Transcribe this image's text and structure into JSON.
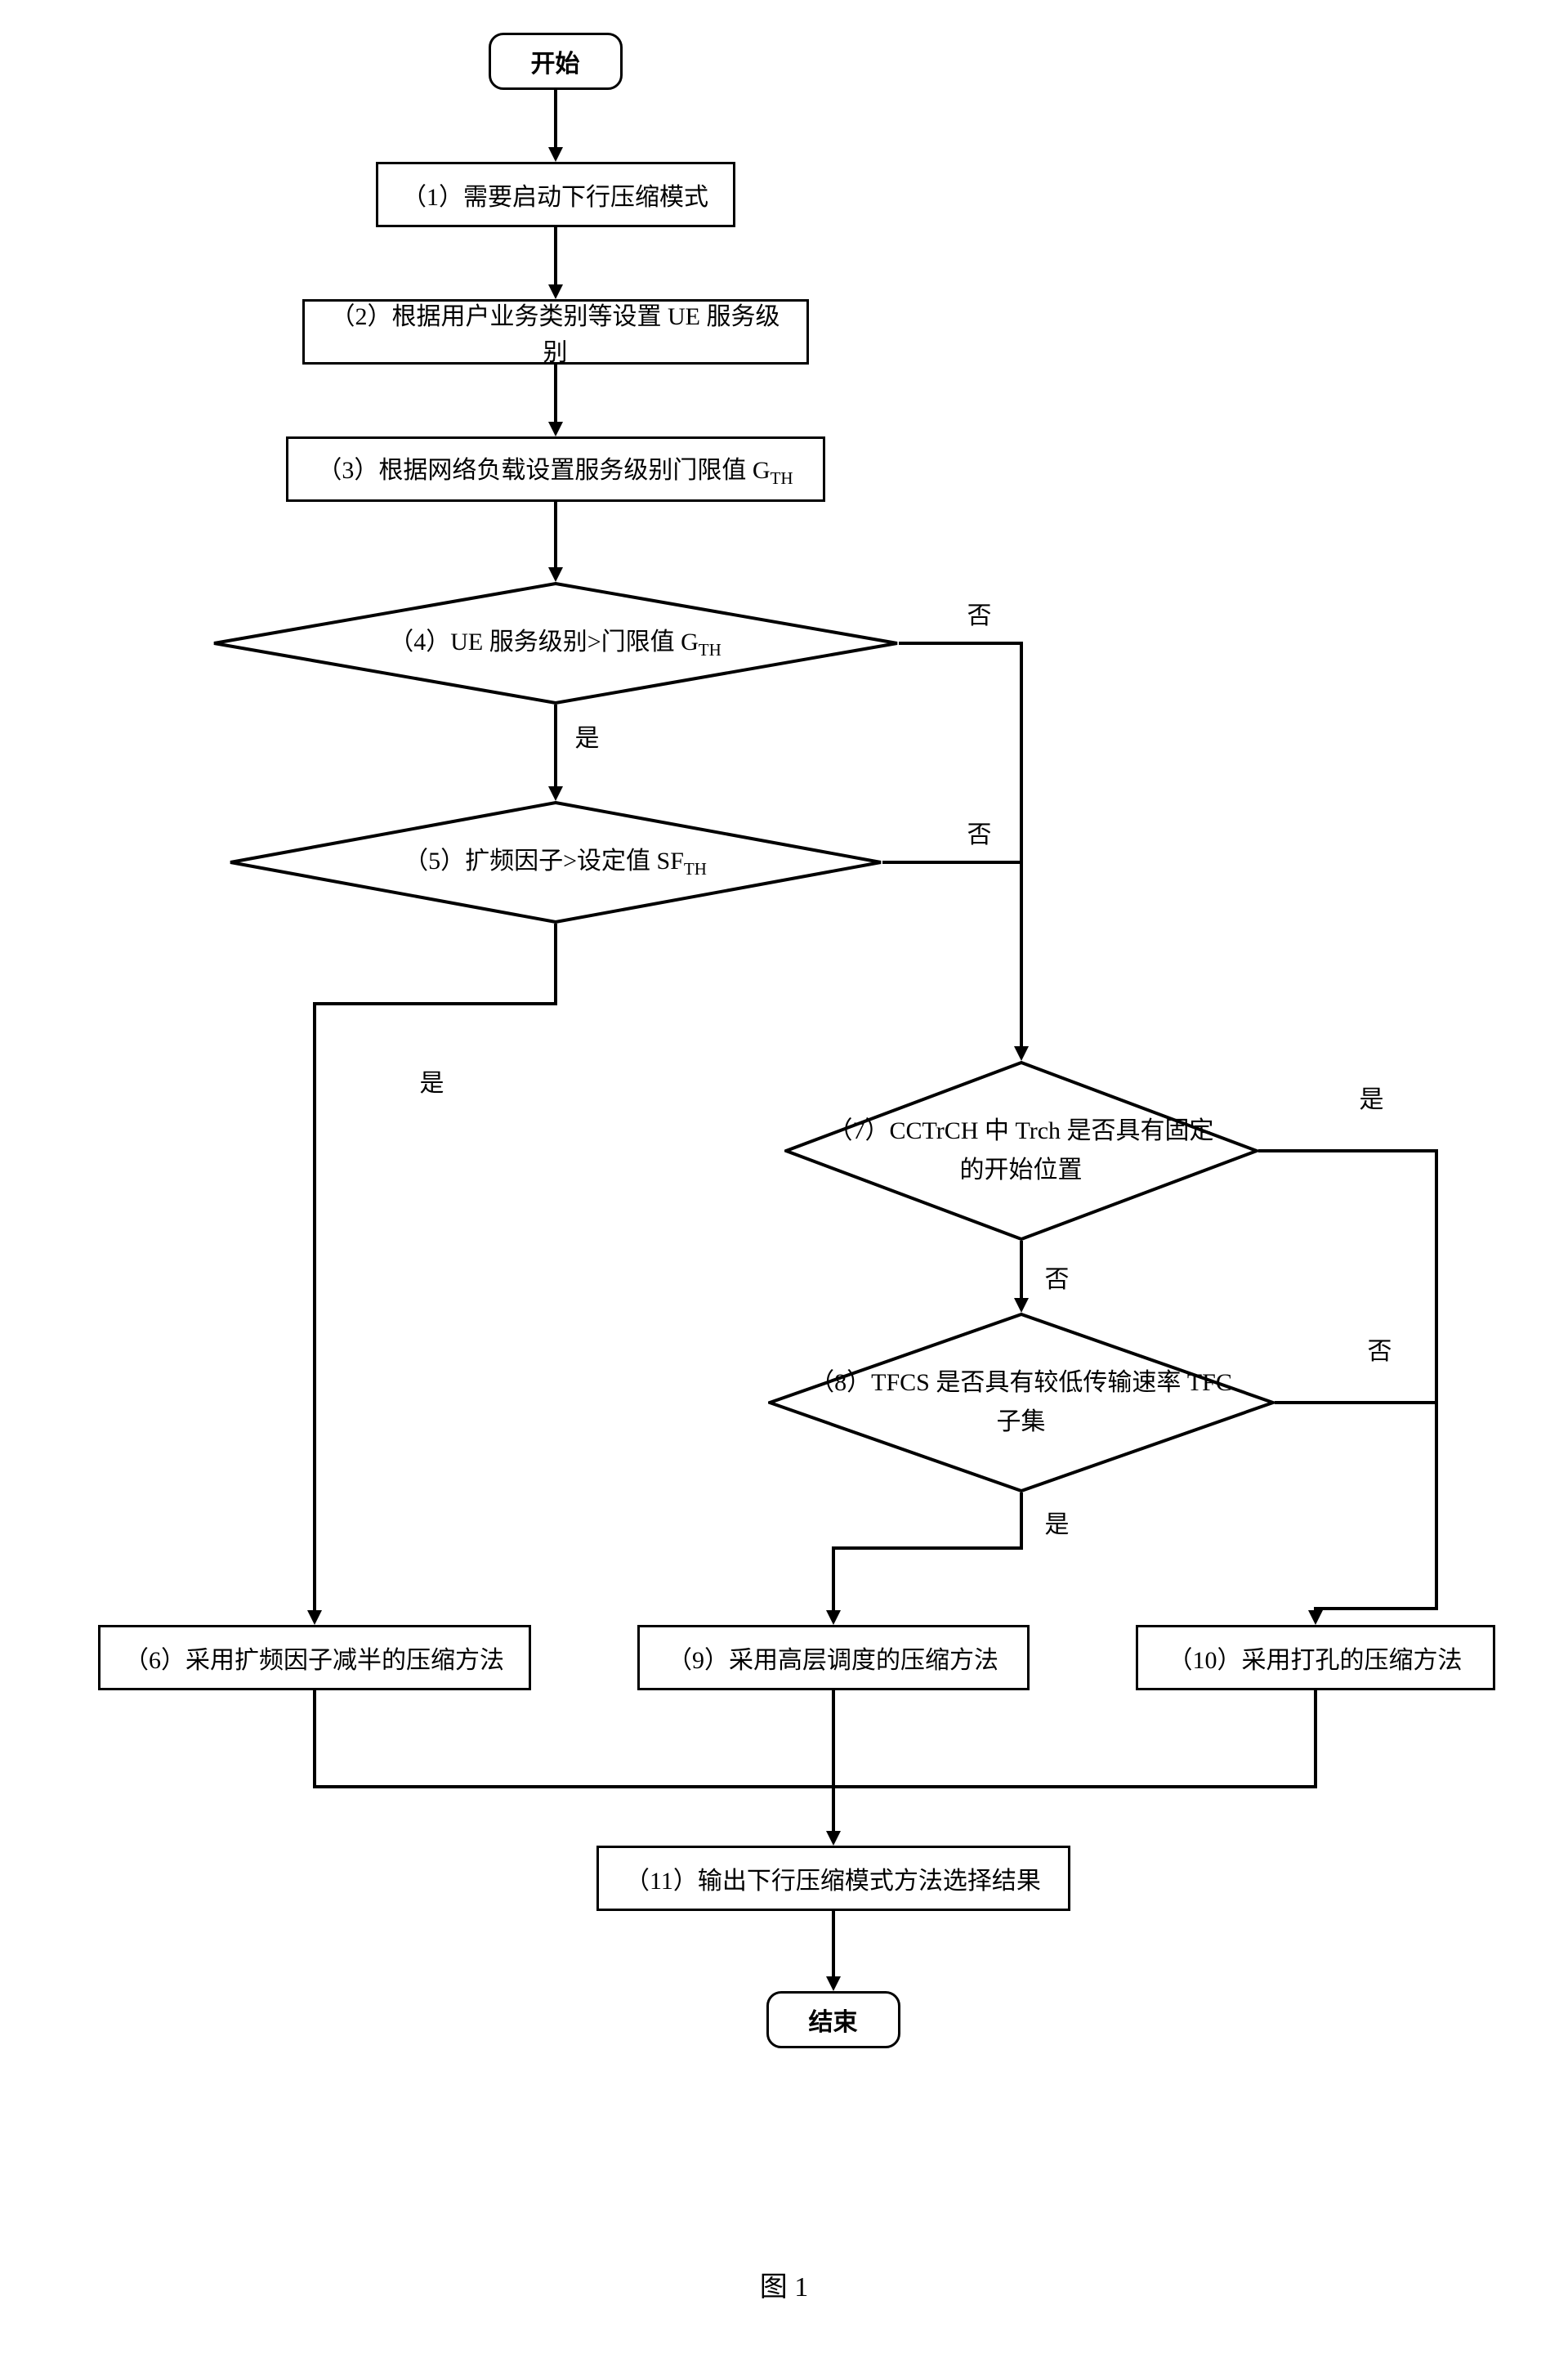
{
  "nodes": {
    "start": "开始",
    "step1": "（1）需要启动下行压缩模式",
    "step2": "（2）根据用户业务类别等设置 UE 服务级别",
    "step3_prefix": "（3）根据网络负载设置服务级别门限值 G",
    "step3_sub": "TH",
    "step4_prefix": "（4）UE 服务级别>门限值 G",
    "step4_sub": "TH",
    "step5_prefix": "（5）扩频因子>设定值 SF",
    "step5_sub": "TH",
    "step6": "（6）采用扩频因子减半的压缩方法",
    "step7": "（7）CCTrCH 中 Trch 是否具有固定的开始位置",
    "step8": "（8）TFCS 是否具有较低传输速率 TFC 子集",
    "step9": "（9）采用高层调度的压缩方法",
    "step10": "（10）采用打孔的压缩方法",
    "step11": "（11）输出下行压缩模式方法选择结果",
    "end": "结束"
  },
  "labels": {
    "yes": "是",
    "no": "否"
  },
  "caption": "图 1"
}
